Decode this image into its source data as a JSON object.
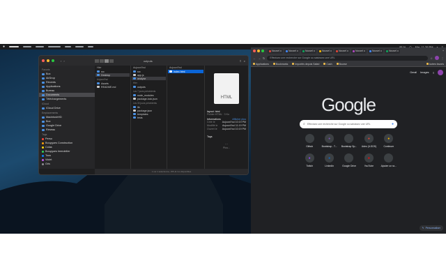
{
  "menubar": {
    "left_items": [
      "Finder",
      "Fichier",
      "Édition",
      "Présentation",
      "Aller",
      "Fenêtre",
      "Aide"
    ],
    "clock": "Mar. 11:26 PM",
    "battery": "95 %"
  },
  "finder": {
    "title": "outputs",
    "sidebar": {
      "favorites_header": "Favoris",
      "favorites": [
        "Box",
        "AirDrop",
        "Récents",
        "Applications",
        "Bureau",
        "Documents",
        "Téléchargements"
      ],
      "icloud_header": "iCloud",
      "icloud": [
        "iCloud Drive"
      ],
      "locations_header": "Emplacements",
      "locations": [
        "MacintoshHD",
        "Box",
        "Google Drive",
        "Réseau"
      ],
      "tags_header": "Tags",
      "tags": [
        {
          "label": "Perso",
          "color": "#ff453a"
        },
        {
          "label": "Bouygues Construction",
          "color": "#ff9f0a"
        },
        {
          "label": "Colas",
          "color": "#ffd60a"
        },
        {
          "label": "Bouygues Immobilier",
          "color": "#30d158"
        },
        {
          "label": "Tous",
          "color": "#0a84ff"
        },
        {
          "label": "Violet",
          "color": "#bf5af2"
        },
        {
          "label": "Gris",
          "color": "#8e8e93"
        }
      ]
    },
    "col1": {
      "head": "Hier",
      "items": [
        "src",
        "Desktop",
        "Aujourd'hui",
        "Assets",
        "README.md"
      ]
    },
    "col2": {
      "head": "Aujourd'hui",
      "items": [
        "src",
        "app.js",
        "analyse"
      ],
      "sub1": "Hier",
      "sub1_items": [
        "outputs"
      ],
      "sub2": "Les 7 jours précédents",
      "sub2_items": [
        "node_modules",
        "package-lock.json"
      ],
      "sub3": "Les 30 jours précédents",
      "sub3_items": [
        "lib",
        "package.json",
        "templates",
        "tests"
      ]
    },
    "col3": {
      "head": "Aujourd'hui",
      "items": [
        "index.html"
      ]
    },
    "preview": {
      "icon_label": "HTML",
      "name": "layout .html",
      "kind": "Fichier HTML · 3 Ko",
      "info_header": "Informations",
      "more": "Afficher plus",
      "rows": [
        [
          "Créé le",
          "Aujourd'hui 10:19 PM"
        ],
        [
          "Modifié le",
          "Aujourd'hui 11:19 PM"
        ],
        [
          "Ouvert le",
          "Aujourd'hui 10:19 PM"
        ]
      ],
      "tags_header": "Tags",
      "more_label": "Plus..."
    },
    "status": "1 sur 1 sélectionné, 155,11 Go disponibles"
  },
  "chrome": {
    "tabs": [
      "Nouvel onglet",
      "Nouvel onglet",
      "Nouvel onglet",
      "Nouvel onglet",
      "Nouvel onglet",
      "Nouvel onglet",
      "Nouvel onglet",
      "Nouvel onglet"
    ],
    "omnibox_placeholder": "Effectuez une recherche sur Google ou saisissez une URL",
    "bookmarks": [
      "Applications",
      "Bookmarks",
      "Importés depuis Safari",
      "Cash",
      "Bourse"
    ],
    "other_bookmarks": "Autres favoris",
    "ntp_links": [
      "Gmail",
      "Images"
    ],
    "logo": "Google",
    "search_placeholder": "Effectuez une recherche sur Google ou saisissez une URL",
    "shortcuts": [
      {
        "label": "Github",
        "color": "#3c4043"
      },
      {
        "label": "Bootstrap - T...",
        "color": "#7952b3"
      },
      {
        "label": "Bootstrap Sp...",
        "color": "#3c4043"
      },
      {
        "label": "Udeo (ILSOS)",
        "color": "#db4437"
      },
      {
        "label": "Continuer",
        "color": "#f4b400"
      },
      {
        "label": "Twitch",
        "color": "#9146ff"
      },
      {
        "label": "LinkedIn",
        "color": "#0a66c2"
      },
      {
        "label": "Google Drive",
        "color": "#3c4043"
      },
      {
        "label": "YouTube",
        "color": "#ff0000"
      },
      {
        "label": "Ajouter un ra...",
        "color": "#3c4043"
      }
    ],
    "customize": "Personnaliser"
  }
}
